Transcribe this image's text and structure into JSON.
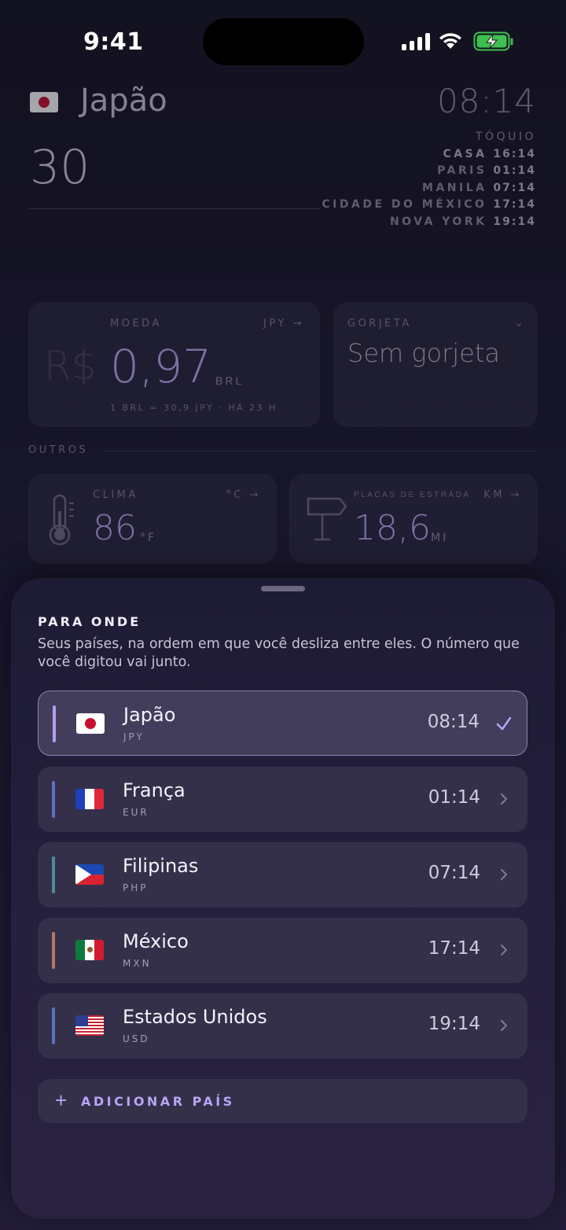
{
  "status_bar": {
    "time": "9:41"
  },
  "header": {
    "country": "Japão",
    "clock": "08:14",
    "amount": "30"
  },
  "zones": {
    "city": "TÓQUIO",
    "rows": [
      {
        "name": "CASA",
        "time": "16:14"
      },
      {
        "name": "PARIS",
        "time": "01:14"
      },
      {
        "name": "MANILA",
        "time": "07:14"
      },
      {
        "name": "CIDADE DO MÉXICO",
        "time": "17:14"
      },
      {
        "name": "NOVA YORK",
        "time": "19:14"
      }
    ]
  },
  "currency_card": {
    "label": "MOEDA",
    "code": "JPY →",
    "symbol": "R$",
    "value": "0,97",
    "unit": "BRL",
    "rate": "1 BRL = 30,9 JPY · HÁ 23 H"
  },
  "tip_card": {
    "label": "GORJETA",
    "value": "Sem gorjeta"
  },
  "others_label": "OUTROS",
  "clima_card": {
    "label": "CLIMA",
    "unit": "°C →",
    "value": "86",
    "suffix": "°F"
  },
  "placas_card": {
    "label": "PLACAS DE ESTRADA",
    "unit": "KM →",
    "value": "18,6",
    "suffix": "MI"
  },
  "sheet": {
    "title": "PARA ONDE",
    "description": "Seus países, na ordem em que você desliza entre eles. O número que você digitou vai junto.",
    "countries": [
      {
        "name": "Japão",
        "code": "JPY",
        "time": "08:14",
        "selected": true,
        "bar_color": "#b39cf0",
        "flag": "jp"
      },
      {
        "name": "França",
        "code": "EUR",
        "time": "01:14",
        "selected": false,
        "bar_color": "#5f6fc2",
        "flag": "fr"
      },
      {
        "name": "Filipinas",
        "code": "PHP",
        "time": "07:14",
        "selected": false,
        "bar_color": "#4f8a9a",
        "flag": "ph"
      },
      {
        "name": "México",
        "code": "MXN",
        "time": "17:14",
        "selected": false,
        "bar_color": "#b37a6a",
        "flag": "mx"
      },
      {
        "name": "Estados Unidos",
        "code": "USD",
        "time": "19:14",
        "selected": false,
        "bar_color": "#5b73b8",
        "flag": "us"
      }
    ],
    "add_label": "ADICIONAR PAÍS"
  },
  "colors": {
    "accent": "#b7a5f5",
    "background": "#17152a",
    "sheet": "#231f3d"
  }
}
